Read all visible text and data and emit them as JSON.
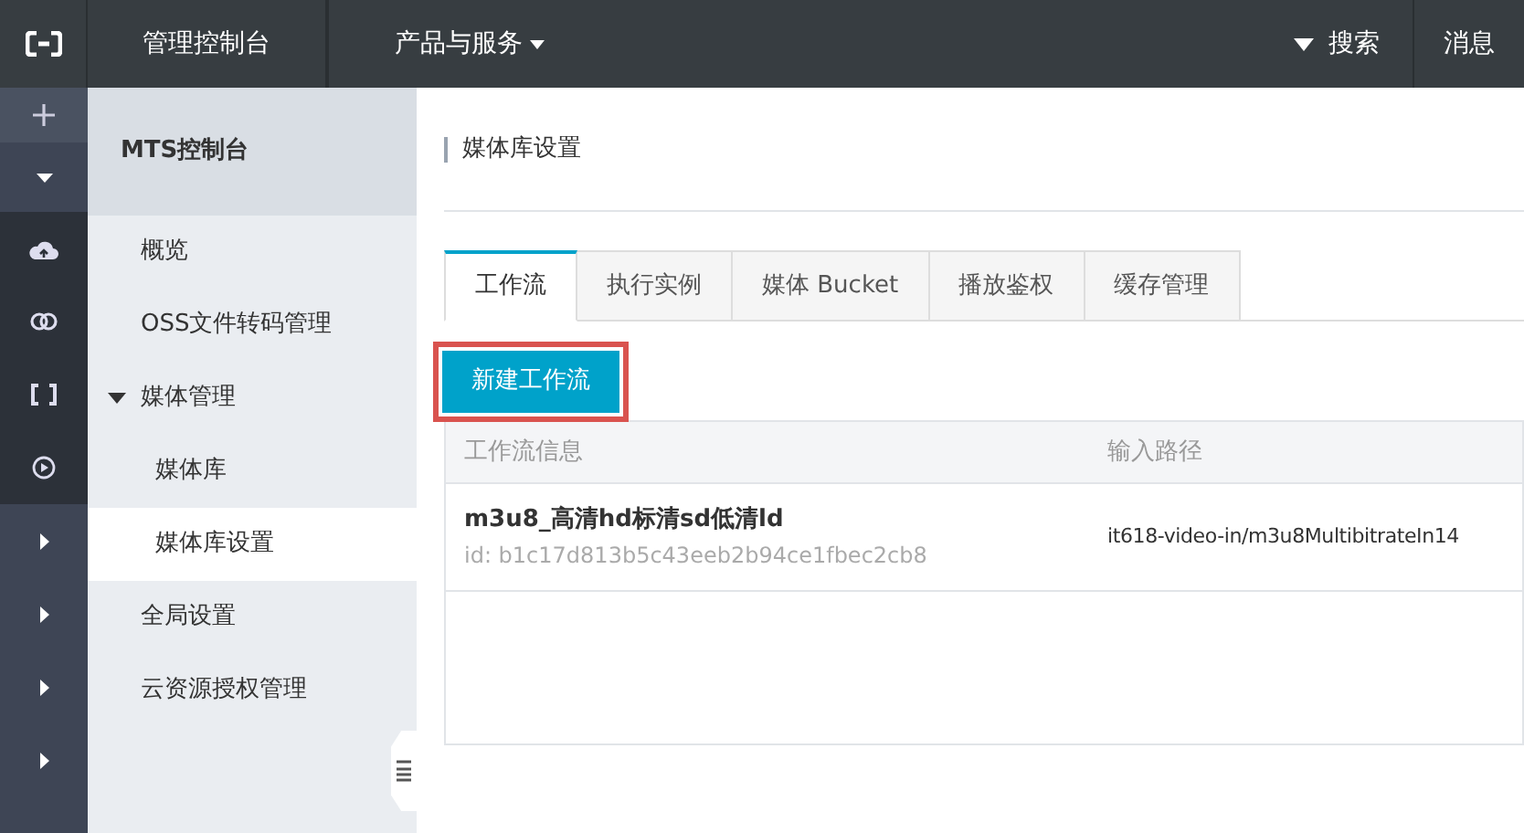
{
  "topbar": {
    "console": "管理控制台",
    "products": "产品与服务",
    "search": "搜索",
    "messages": "消息"
  },
  "rail": [
    {
      "kind": "plus"
    },
    {
      "kind": "caret-down"
    },
    {
      "kind": "cloud"
    },
    {
      "kind": "link"
    },
    {
      "kind": "bracket"
    },
    {
      "kind": "play"
    },
    {
      "kind": "caret-right"
    },
    {
      "kind": "caret-right"
    },
    {
      "kind": "caret-right"
    },
    {
      "kind": "caret-right"
    }
  ],
  "sidebar": {
    "title": "MTS控制台",
    "items": [
      {
        "label": "概览",
        "selected": false
      },
      {
        "label": "OSS文件转码管理",
        "selected": false
      },
      {
        "label": "媒体管理",
        "selected": false,
        "expanded": true,
        "children": [
          {
            "label": "媒体库",
            "selected": false
          },
          {
            "label": "媒体库设置",
            "selected": true
          }
        ]
      },
      {
        "label": "全局设置",
        "selected": false
      },
      {
        "label": "云资源授权管理",
        "selected": false
      }
    ]
  },
  "page_title": "媒体库设置",
  "tabs": [
    {
      "label": "工作流",
      "selected": true
    },
    {
      "label": "执行实例",
      "selected": false
    },
    {
      "label": "媒体 Bucket",
      "selected": false
    },
    {
      "label": "播放鉴权",
      "selected": false
    },
    {
      "label": "缓存管理",
      "selected": false
    }
  ],
  "new_button": {
    "label": "新建工作流",
    "highlighted": true
  },
  "table": {
    "columns": [
      "工作流信息",
      "输入路径"
    ],
    "rows": [
      {
        "name": "m3u8_高清hd标清sd低清ld",
        "id": "id: b1c17d813b5c43eeb2b94ce1fbec2cb8",
        "input_path": "it618-video-in/m3u8MultibitrateIn14"
      }
    ]
  }
}
